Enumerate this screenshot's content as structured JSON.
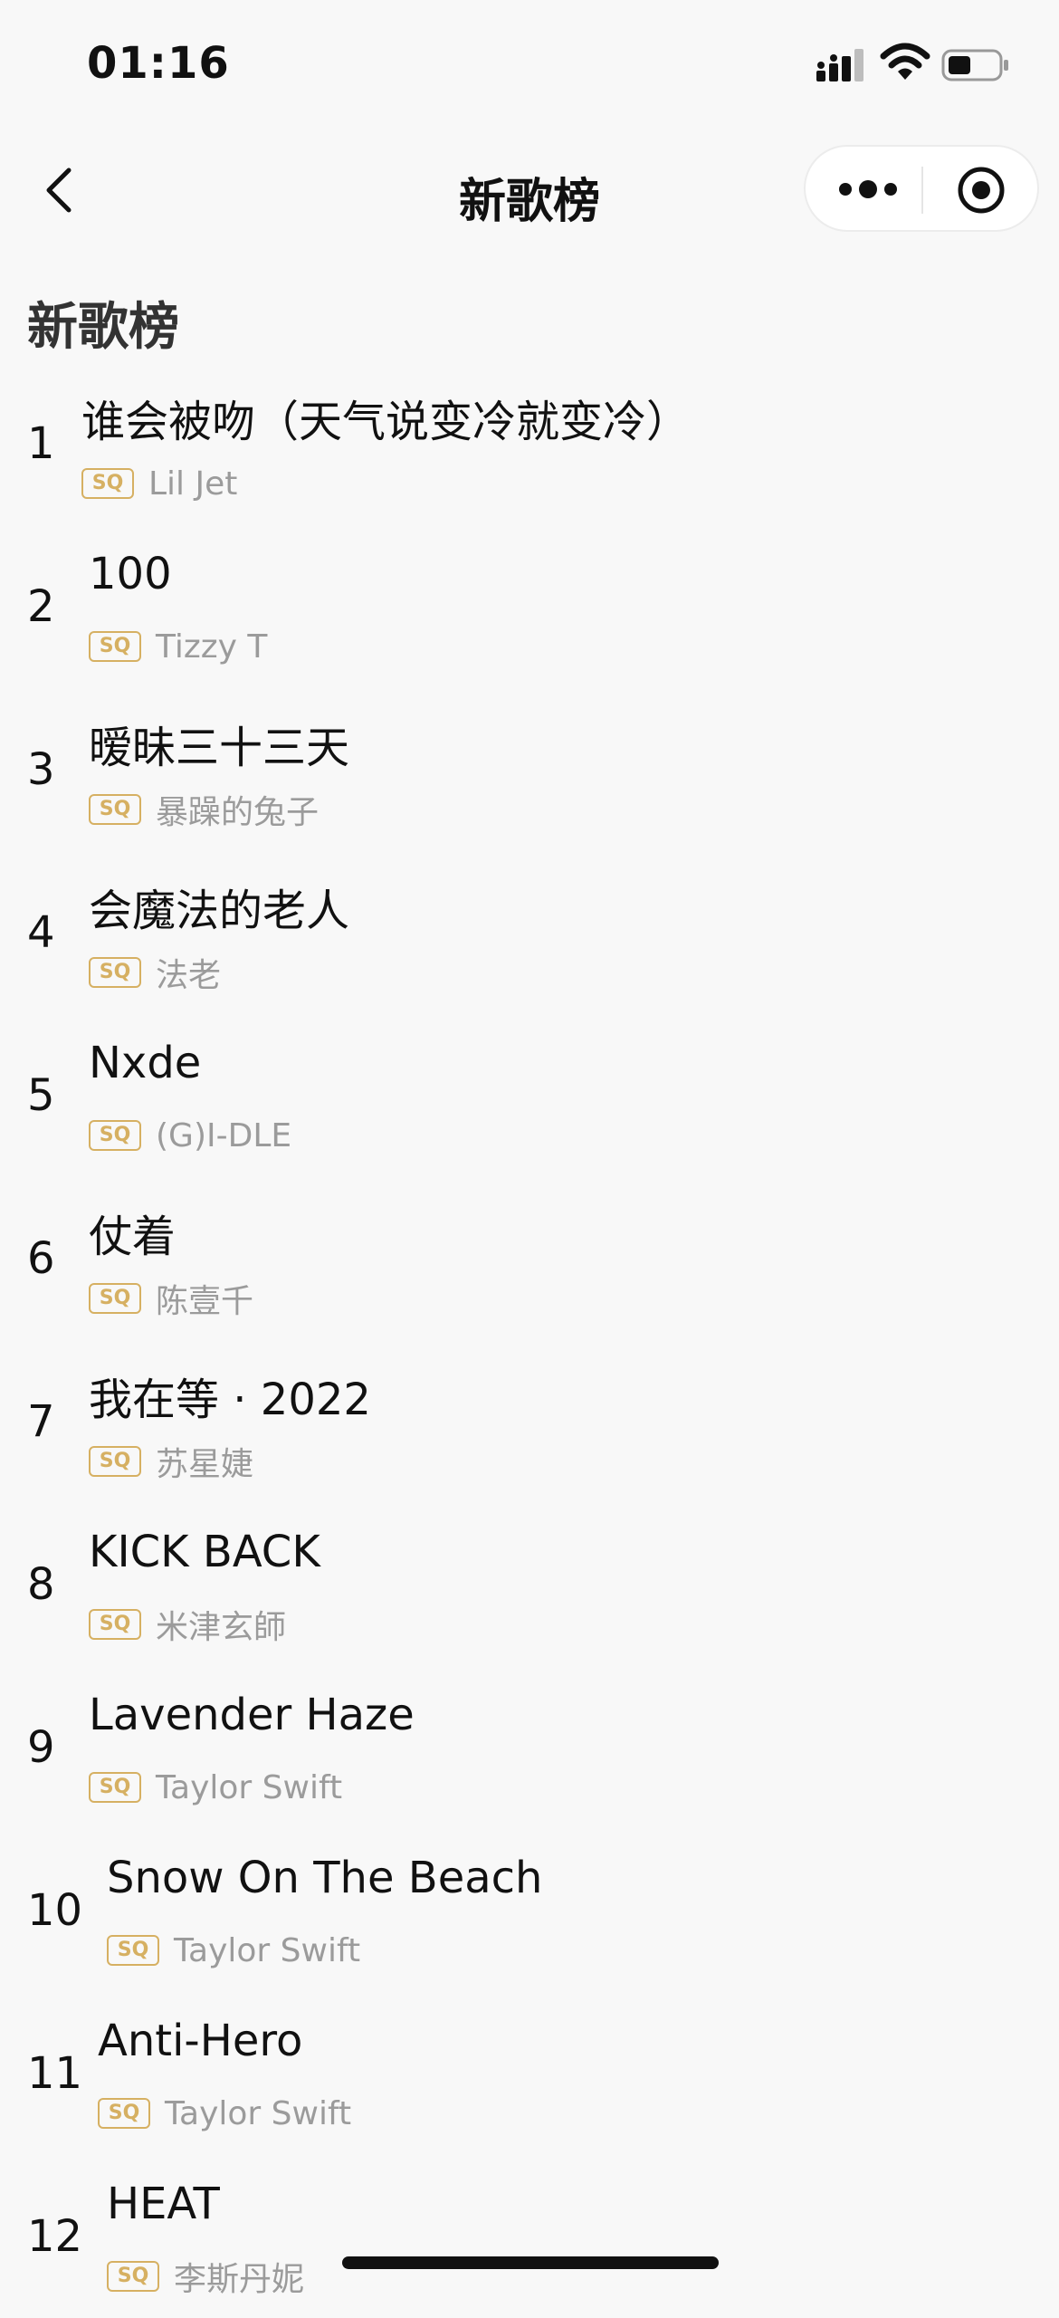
{
  "status_bar": {
    "time": "01:16"
  },
  "nav": {
    "title": "新歌榜"
  },
  "section": {
    "title": "新歌榜"
  },
  "badge": "SQ",
  "songs": [
    {
      "rank": "1",
      "title": "谁会被吻（天气说变冷就变冷）",
      "artist": "Lil Jet"
    },
    {
      "rank": "2",
      "title": "100",
      "artist": "Tizzy T"
    },
    {
      "rank": "3",
      "title": "暧昧三十三天",
      "artist": "暴躁的兔子"
    },
    {
      "rank": "4",
      "title": "会魔法的老人",
      "artist": "法老"
    },
    {
      "rank": "5",
      "title": "Nxde",
      "artist": "(G)I-DLE"
    },
    {
      "rank": "6",
      "title": "仗着",
      "artist": "陈壹千"
    },
    {
      "rank": "7",
      "title": "我在等 · 2022",
      "artist": "苏星婕"
    },
    {
      "rank": "8",
      "title": "KICK BACK",
      "artist": "米津玄師"
    },
    {
      "rank": "9",
      "title": "Lavender Haze",
      "artist": "Taylor Swift"
    },
    {
      "rank": "10",
      "title": "Snow On The Beach",
      "artist": "Taylor Swift"
    },
    {
      "rank": "11",
      "title": "Anti-Hero",
      "artist": "Taylor Swift"
    },
    {
      "rank": "12",
      "title": "HEAT",
      "artist": "李斯丹妮"
    }
  ],
  "colors": {
    "badge": "#d6b062",
    "artist": "#9b9b9b",
    "background": "#f8f8f8"
  },
  "icons": [
    "signal-icon",
    "wifi-icon",
    "battery-icon",
    "back-arrow-icon",
    "more-dots-icon",
    "target-circle-icon"
  ]
}
